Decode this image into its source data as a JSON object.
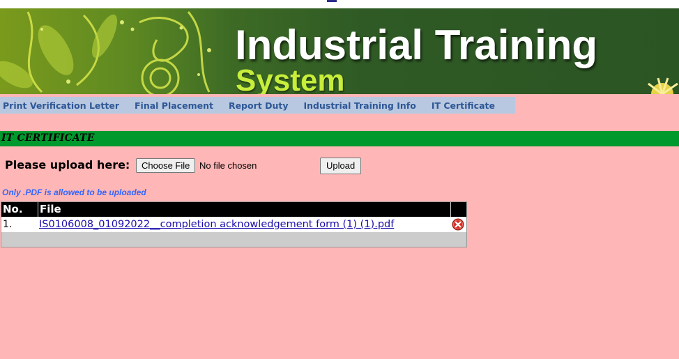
{
  "header": {
    "title": "Industrial Training",
    "subtitle": "System"
  },
  "nav": {
    "items": [
      {
        "label": "Print Verification Letter"
      },
      {
        "label": "Final Placement"
      },
      {
        "label": "Report Duty"
      },
      {
        "label": "Industrial Training Info"
      },
      {
        "label": "IT Certificate"
      }
    ]
  },
  "section": {
    "title": "IT CERTIFICATE"
  },
  "upload": {
    "label": "Please upload here:",
    "choose_file_label": "Choose File",
    "file_status": "No file chosen",
    "upload_button_label": "Upload",
    "hint": "Only .PDF is allowed to be uploaded"
  },
  "table": {
    "columns": [
      "No.",
      "File",
      ""
    ],
    "rows": [
      {
        "no": "1.",
        "file": "IS0106008_01092022__completion acknowledgement form (1) (1).pdf",
        "action_icon": "delete-icon"
      }
    ]
  },
  "colors": {
    "page_background": "#ffb6b6",
    "navbar": "#b8c8e0",
    "nav_text": "#2e5796",
    "section_bar": "#00992e",
    "hint_text": "#3366ff",
    "table_header": "#000000",
    "link": "#1a0dab",
    "delete_icon": "#d93025"
  }
}
